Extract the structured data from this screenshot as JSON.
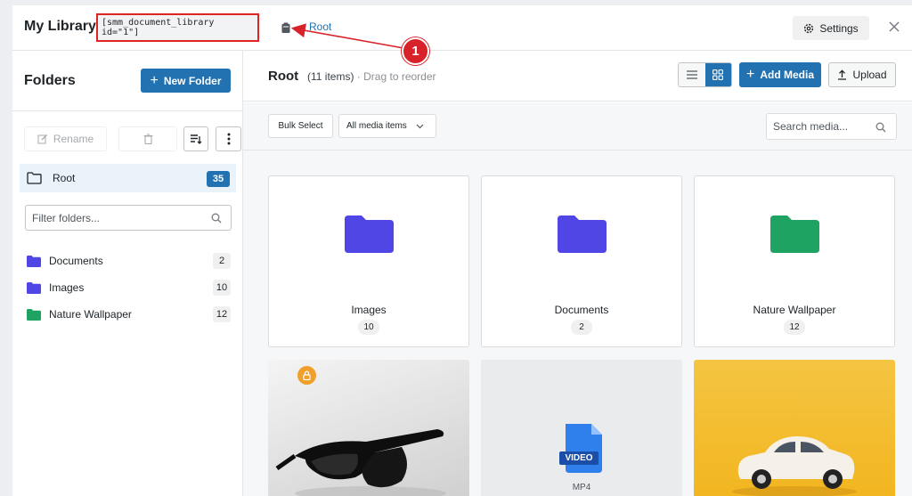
{
  "header": {
    "title": "My Library",
    "shortcode": "[smm_document_library id=\"1\"]",
    "breadcrumb_root": "Root",
    "settings_label": "Settings"
  },
  "sidebar": {
    "title": "Folders",
    "new_folder_label": "New Folder",
    "rename_label": "Rename",
    "root": {
      "label": "Root",
      "count": "35"
    },
    "filter_placeholder": "Filter folders...",
    "folders": [
      {
        "label": "Documents",
        "count": "2",
        "color": "#4f46e5"
      },
      {
        "label": "Images",
        "count": "10",
        "color": "#4f46e5"
      },
      {
        "label": "Nature Wallpaper",
        "count": "12",
        "color": "#1ea362"
      }
    ]
  },
  "main": {
    "title": "Root",
    "item_count": "(11 items)",
    "separator": "·",
    "hint": "Drag to reorder",
    "add_media_label": "Add Media",
    "upload_label": "Upload",
    "bulk_select_label": "Bulk Select",
    "filter_value": "All media items",
    "search_placeholder": "Search media...",
    "folder_cards": [
      {
        "label": "Images",
        "count": "10",
        "color": "#4f46e5"
      },
      {
        "label": "Documents",
        "count": "2",
        "color": "#4f46e5"
      },
      {
        "label": "Nature Wallpaper",
        "count": "12",
        "color": "#1ea362"
      }
    ],
    "media": [
      {
        "kind": "image",
        "subject": "sunglasses",
        "locked": true
      },
      {
        "kind": "video",
        "badge": "VIDEO",
        "label": "MP4"
      },
      {
        "kind": "image",
        "subject": "toy-car"
      }
    ]
  },
  "annotation": {
    "number": "1",
    "color": "#d8222a"
  },
  "colors": {
    "primary": "#2271b1",
    "callout": "#e02424",
    "lock": "#f0a02a"
  }
}
